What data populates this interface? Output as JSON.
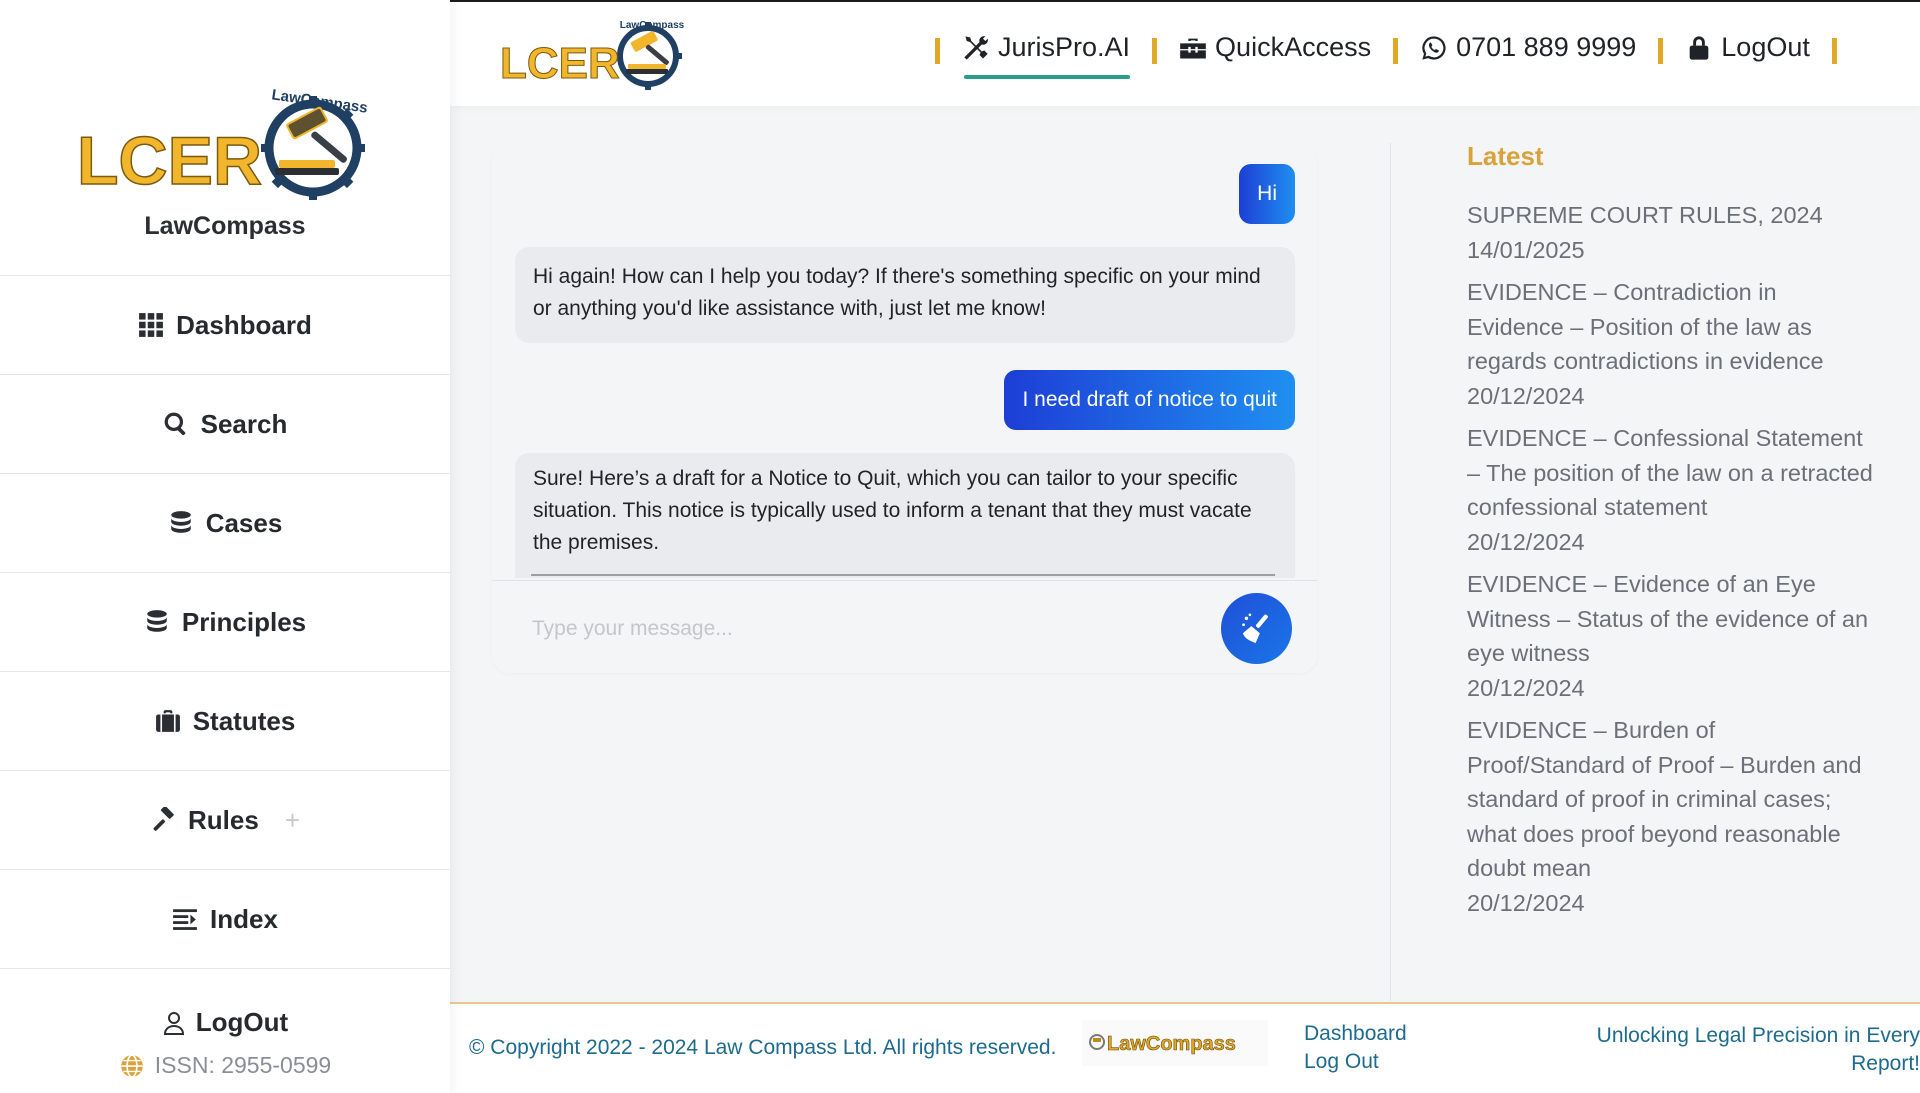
{
  "brand": {
    "logo_text": "LCER",
    "logo_arc_text": "LawCompass",
    "name": "LawCompass"
  },
  "sidebar": {
    "items": [
      {
        "label": "Dashboard",
        "icon": "grid-icon"
      },
      {
        "label": "Search",
        "icon": "search-icon"
      },
      {
        "label": "Cases",
        "icon": "database-icon"
      },
      {
        "label": "Principles",
        "icon": "database-icon"
      },
      {
        "label": "Statutes",
        "icon": "briefcase-icon"
      },
      {
        "label": "Rules",
        "icon": "gavel-icon",
        "expand": "+"
      },
      {
        "label": "Index",
        "icon": "list-icon"
      }
    ],
    "logout_label": "LogOut",
    "issn": "ISSN: 2955-0599"
  },
  "topnav": {
    "items": [
      {
        "label": "JurisPro.AI",
        "icon": "tools-icon"
      },
      {
        "label": "QuickAccess",
        "icon": "toolbox-icon"
      },
      {
        "label": "0701 889 9999",
        "icon": "whatsapp-icon"
      },
      {
        "label": "LogOut",
        "icon": "lock-icon"
      }
    ]
  },
  "chat": {
    "messages": [
      {
        "role": "user",
        "text": "Hi"
      },
      {
        "role": "assistant",
        "text": "Hi again! How can I help you today? If there's something specific on your mind or anything you'd like assistance with, just let me know!"
      },
      {
        "role": "user",
        "text": "I need draft of notice to quit"
      },
      {
        "role": "assistant",
        "text": "Sure! Here’s a draft for a Notice to Quit, which you can tailor to your specific situation. This notice is typically used to inform a tenant that they must vacate the premises."
      }
    ],
    "input_placeholder": "Type your message...",
    "send_icon": "broom-icon"
  },
  "latest": {
    "title": "Latest",
    "items": [
      {
        "title": "SUPREME COURT RULES, 2024",
        "date": "14/01/2025"
      },
      {
        "title": "EVIDENCE – Contradiction in Evidence – Position of the law as regards contradictions in evidence",
        "date": "20/12/2024"
      },
      {
        "title": "EVIDENCE – Confessional Statement – The position of the law on a retracted confessional statement",
        "date": "20/12/2024"
      },
      {
        "title": "EVIDENCE – Evidence of an Eye Witness – Status of the evidence of an eye witness",
        "date": "20/12/2024"
      },
      {
        "title": "EVIDENCE – Burden of Proof/Standard of Proof – Burden and standard of proof in criminal cases; what does proof beyond reasonable doubt mean",
        "date": "20/12/2024"
      }
    ]
  },
  "footer": {
    "copyright": "© Copyright 2022 - 2024 Law Compass Ltd. All rights reserved.",
    "logo_text": "LawCompass",
    "links": [
      "Dashboard",
      "Log Out"
    ],
    "tagline": "Unlocking Legal Precision in Every Report!"
  },
  "colors": {
    "accent_gold": "#e0a826",
    "active_underline": "#2a9d8f",
    "user_bubble_start": "#1d3ed6",
    "user_bubble_end": "#1f8ff0",
    "latest_title": "#d9a23a",
    "footer_text": "#1d6b8d"
  }
}
